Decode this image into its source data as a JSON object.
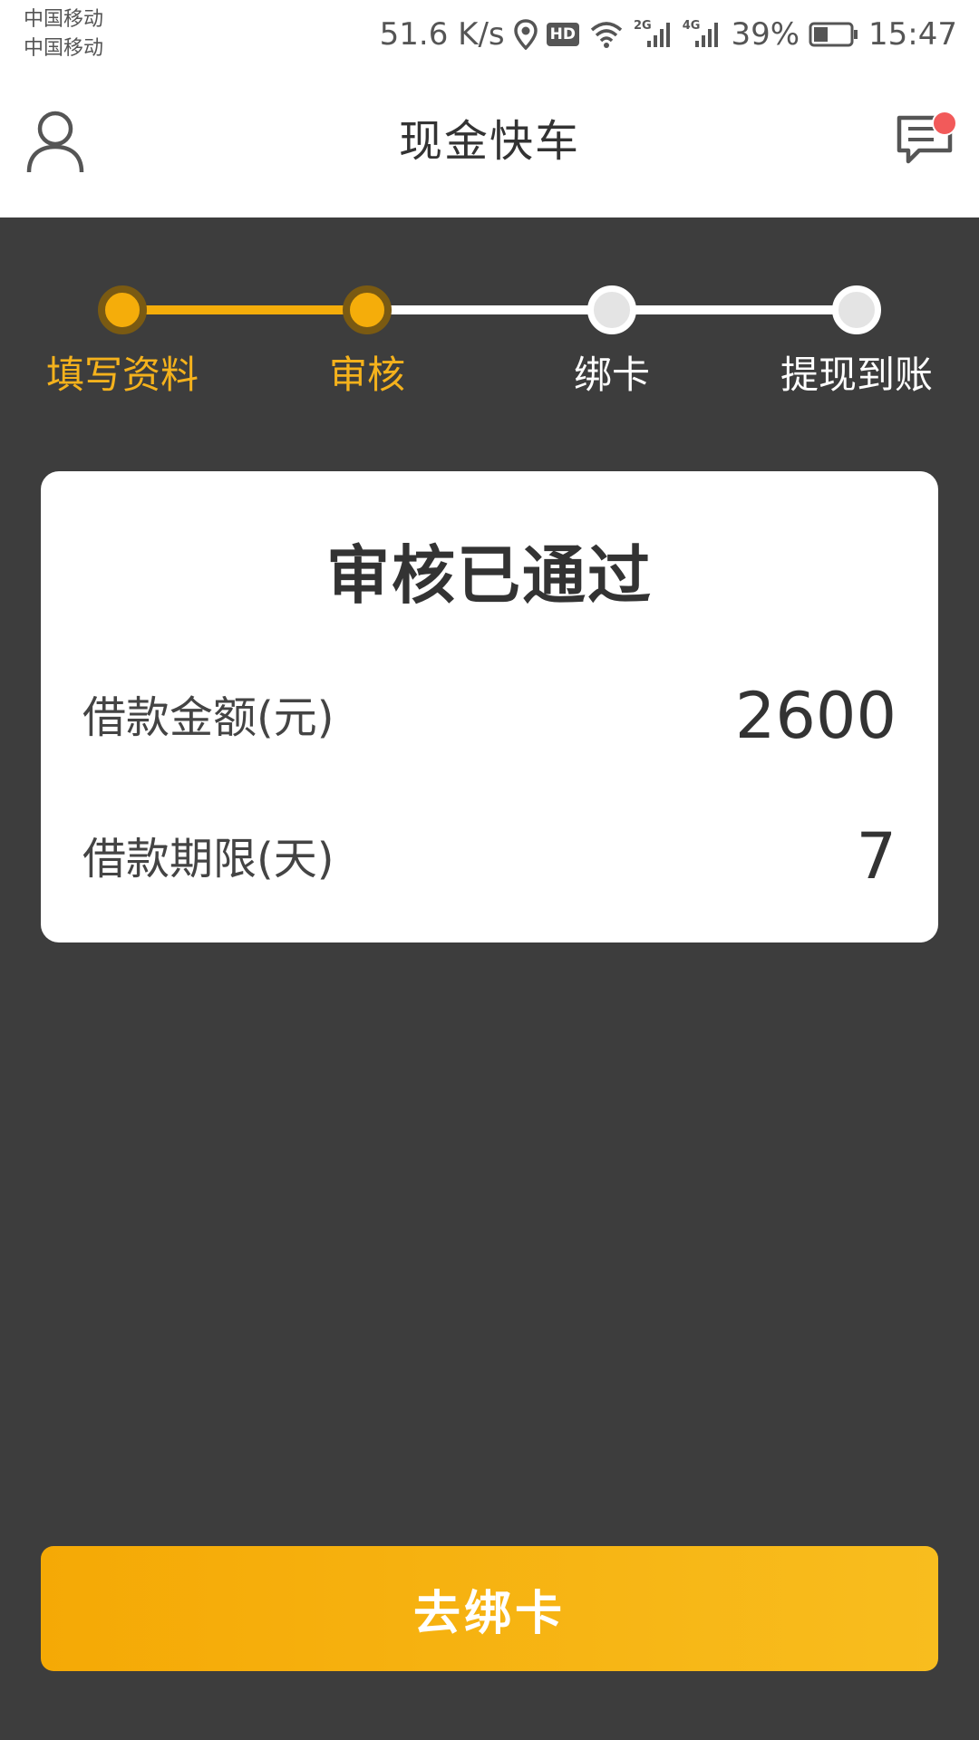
{
  "status_bar": {
    "carrier_1": "中国移动",
    "carrier_2": "中国移动",
    "speed": "51.6 K/s",
    "hd_badge": "HD",
    "net_2g": "2G",
    "net_4g": "4G",
    "battery_percent": "39%",
    "battery_level": 0.39,
    "time": "15:47",
    "icons": [
      "location-icon",
      "hd-icon",
      "wifi-icon",
      "signal-2g-icon",
      "signal-4g-icon",
      "battery-icon"
    ]
  },
  "nav": {
    "title": "现金快车",
    "left_icon": "user-icon",
    "right_icon": "message-icon",
    "has_notification": true
  },
  "stepper": {
    "steps": [
      {
        "label": "填写资料",
        "state": "active"
      },
      {
        "label": "审核",
        "state": "active"
      },
      {
        "label": "绑卡",
        "state": "inactive"
      },
      {
        "label": "提现到账",
        "state": "inactive"
      }
    ]
  },
  "card": {
    "title": "审核已通过",
    "rows": [
      {
        "label": "借款金额(元)",
        "value": "2600"
      },
      {
        "label": "借款期限(天)",
        "value": "7"
      }
    ]
  },
  "action": {
    "button_label": "去绑卡"
  },
  "colors": {
    "accent": "#f5ad0a",
    "background": "#3d3d3d",
    "notification": "#f25a5a"
  }
}
